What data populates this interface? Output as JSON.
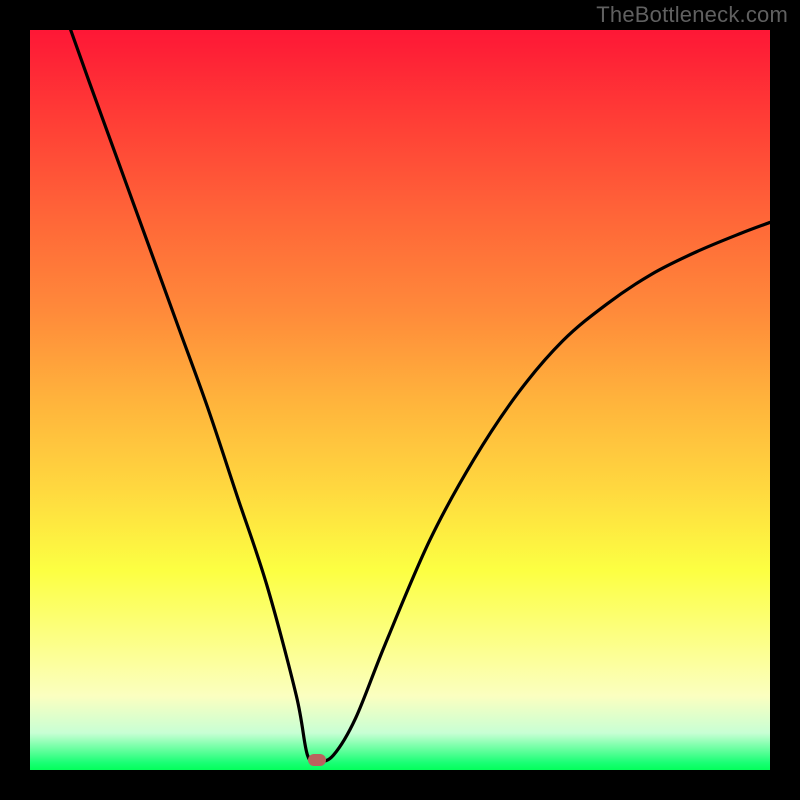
{
  "watermark": "TheBottleneck.com",
  "chart_data": {
    "type": "line",
    "title": "",
    "xlabel": "",
    "ylabel": "",
    "xlim": [
      0,
      1
    ],
    "ylim": [
      0,
      1
    ],
    "curve": {
      "name": "bottleneck-curve",
      "x": [
        0.055,
        0.08,
        0.12,
        0.16,
        0.2,
        0.24,
        0.28,
        0.32,
        0.36,
        0.375,
        0.39,
        0.41,
        0.44,
        0.48,
        0.54,
        0.6,
        0.66,
        0.72,
        0.78,
        0.84,
        0.9,
        0.96,
        1.0
      ],
      "y": [
        1.0,
        0.93,
        0.82,
        0.71,
        0.6,
        0.49,
        0.37,
        0.25,
        0.1,
        0.02,
        0.012,
        0.02,
        0.07,
        0.17,
        0.31,
        0.42,
        0.51,
        0.58,
        0.63,
        0.67,
        0.7,
        0.725,
        0.74
      ]
    },
    "minimum_marker": {
      "x": 0.388,
      "y": 0.014
    },
    "background_gradient": {
      "stops": [
        {
          "offset": 0.0,
          "color": "#fe1736"
        },
        {
          "offset": 0.12,
          "color": "#ff3d36"
        },
        {
          "offset": 0.25,
          "color": "#ff6538"
        },
        {
          "offset": 0.38,
          "color": "#ff8a3a"
        },
        {
          "offset": 0.5,
          "color": "#ffb33c"
        },
        {
          "offset": 0.62,
          "color": "#ffd83f"
        },
        {
          "offset": 0.73,
          "color": "#fcff42"
        },
        {
          "offset": 0.83,
          "color": "#fcff8a"
        },
        {
          "offset": 0.9,
          "color": "#fbffc0"
        },
        {
          "offset": 0.95,
          "color": "#c8ffd4"
        },
        {
          "offset": 0.99,
          "color": "#1aff75"
        },
        {
          "offset": 1.0,
          "color": "#03ff5b"
        }
      ]
    }
  }
}
